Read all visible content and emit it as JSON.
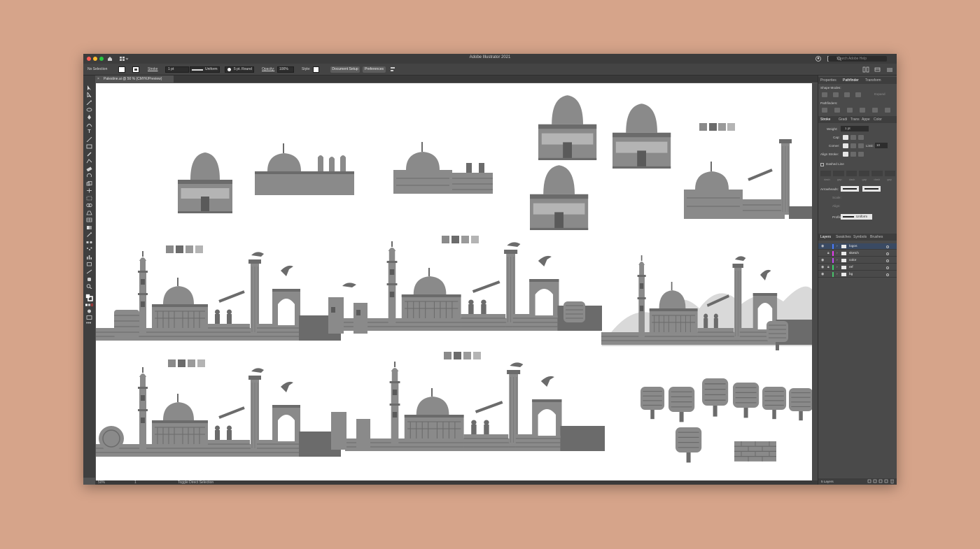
{
  "window": {
    "title": "Adobe Illustrator 2021",
    "help_placeholder": "Search Adobe Help"
  },
  "control_bar": {
    "selection": "No Selection",
    "stroke_label": "Stroke",
    "stroke_weight": "1 pt",
    "stroke_profile": "Uniform",
    "brush": "5 pt. Round",
    "opacity_label": "Opacity:",
    "opacity_value": "100%",
    "style_label": "Style:",
    "document_setup": "Document Setup",
    "preferences": "Preferences"
  },
  "document_tab": {
    "name": "Palestine.ai @ 50 % (CMYK/Preview)"
  },
  "status_bar": {
    "zoom": "50%",
    "artboard": "1",
    "tool_info": "Toggle Direct Selection"
  },
  "panels": {
    "top_tabs": [
      "Properties",
      "Pathfinder",
      "Transform"
    ],
    "active_top_tab": "Pathfinder",
    "shape_modes_label": "Shape Modes:",
    "expand_label": "Expand",
    "pathfinders_label": "Pathfinders:",
    "stroke_tabs": [
      "Stroke",
      "Gradi",
      "Trans",
      "Appe",
      "Color"
    ],
    "weight_label": "Weight:",
    "weight_value": "1 pt",
    "cap_label": "Cap:",
    "corner_label": "Corner:",
    "limit_label": "Limit:",
    "limit_value": "10",
    "align_stroke_label": "Align Stroke:",
    "dashed_line_label": "Dashed Line",
    "dash_labels": [
      "dash",
      "gap",
      "dash",
      "gap",
      "dash",
      "gap"
    ],
    "arrowheads_label": "Arrowheads:",
    "scale_label": "Scale:",
    "align_label": "Align:",
    "profile_label": "Profile:",
    "profile_value": "Uniform",
    "layer_tabs": [
      "Layers",
      "Swatches",
      "Symbols",
      "Brushes"
    ],
    "layers": [
      {
        "name": "logos",
        "color": "#4a7cff",
        "visible": true,
        "locked": false,
        "selected": true
      },
      {
        "name": "sketch",
        "color": "#e63cf0",
        "visible": false,
        "locked": true,
        "selected": false
      },
      {
        "name": "color",
        "color": "#c34cf2",
        "visible": true,
        "locked": false,
        "selected": false
      },
      {
        "name": "ref",
        "color": "#3dd16c",
        "visible": true,
        "locked": true,
        "selected": false
      },
      {
        "name": "bg",
        "color": "#49c26a",
        "visible": true,
        "locked": false,
        "selected": false
      }
    ],
    "layers_count": "5 Layers"
  },
  "colors": {
    "app_bg": "#535353",
    "panel_bg": "#4a4a4a",
    "artboard": "#ffffff",
    "art_mid": "#8a8a8a",
    "art_dark": "#6b6b6b",
    "art_light": "#b4b4b4"
  }
}
